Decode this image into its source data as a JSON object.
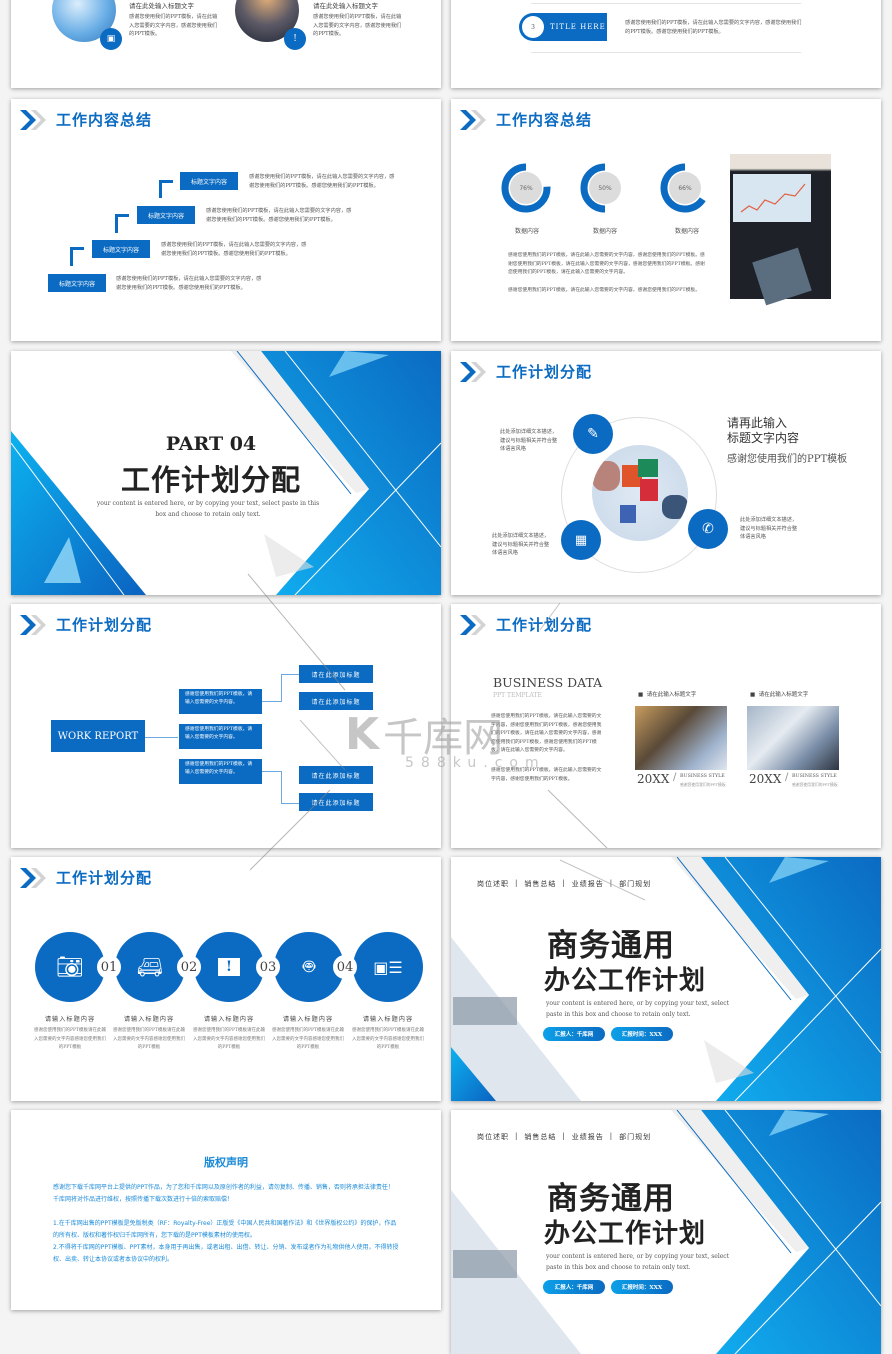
{
  "header_icon": "double-chevron-icon",
  "slide1": {
    "items": [
      {
        "title": "请在此处输入标题文字",
        "body": "感谢您使用我们的PPT模板，请在此输入您需要的文字内容，感谢您使用我们的PPT模板。",
        "icon": "presentation-icon"
      },
      {
        "title": "请在此处输入标题文字",
        "body": "感谢您使用我们的PPT模板，请在此输入您需要的文字内容，感谢您使用我们的PPT模板。",
        "icon": "chat-alert-icon"
      }
    ]
  },
  "slide2": {
    "number": "3",
    "title": "TITLE HERE",
    "body": "感谢您使用我们的PPT模板，请在此输入您需要的文字内容，感谢您使用我们的PPT模板。感谢您使用我们的PPT模板。"
  },
  "slide3": {
    "heading": "工作内容总结",
    "steps": [
      {
        "label": "标题文字内容",
        "body": "感谢您使用我们的PPT模板，请在此输入您需要的文字内容，感谢您使用我们的PPT模板。感谢您使用我们的PPT模板。"
      },
      {
        "label": "标题文字内容",
        "body": "感谢您使用我们的PPT模板，请在此输入您需要的文字内容，感谢您使用我们的PPT模板。感谢您使用我们的PPT模板。"
      },
      {
        "label": "标题文字内容",
        "body": "感谢您使用我们的PPT模板，请在此输入您需要的文字内容，感谢您使用我们的PPT模板。感谢您使用我们的PPT模板。"
      },
      {
        "label": "标题文字内容",
        "body": "感谢您使用我们的PPT模板，请在此输入您需要的文字内容，感谢您使用我们的PPT模板。感谢您使用我们的PPT模板。"
      }
    ]
  },
  "slide4": {
    "heading": "工作内容总结",
    "donuts": [
      {
        "value": 76,
        "text": "76%",
        "label": "数据内容"
      },
      {
        "value": 50,
        "text": "50%",
        "label": "数据内容"
      },
      {
        "value": 66,
        "text": "66%",
        "label": "数据内容"
      }
    ],
    "para1": "感谢您使用我们的PPT模板，请在此输入您需要的文字内容，感谢您使用我们的PPT模板。感谢您使用我们的PPT模板，请在此输入您需要的文字内容，感谢您使用我们的PPT模板。感谢您使用我们的PPT模板，请在此输入您需要的文字内容。",
    "para2": "感谢您使用我们的PPT模板，请在此输入您需要的文字内容，感谢您使用我们的PPT模板。",
    "image": "laptop-chart-photo"
  },
  "slide5": {
    "part": "PART 04",
    "title": "工作计划分配",
    "subtitle": "your content is entered here, or by copying your text, select paste in this box and choose to retain only text."
  },
  "slide6": {
    "heading": "工作计划分配",
    "nodes": [
      {
        "icon": "document-edit-icon",
        "text": "此处添加详细文本描述，建议与标题相关并符合整体语言风格"
      },
      {
        "icon": "calendar-icon",
        "text": "此处添加详细文本描述，建议与标题相关并符合整体语言风格"
      },
      {
        "icon": "phone-icon",
        "text": "此处添加详细文本描述，建议与标题相关并符合整体语言风格"
      }
    ],
    "title_line1": "请再此输入",
    "title_line2": "标题文字内容",
    "body": "感谢您使用我们的PPT模板",
    "image": "puzzle-hands-photo"
  },
  "slide7": {
    "heading": "工作计划分配",
    "root": "WORK REPORT",
    "mid": [
      "感谢您使用我们的PPT模板，请输入您需要的文字内容。",
      "感谢您使用我们的PPT模板，请输入您需要的文字内容。",
      "感谢您使用我们的PPT模板，请输入您需要的文字内容。"
    ],
    "leaves": [
      "请在此添加标题",
      "请在此添加标题",
      "请在此添加标题",
      "请在此添加标题"
    ]
  },
  "slide8": {
    "heading": "工作计划分配",
    "title": "BUSINESS DATA",
    "subtitle": "PPT TEMPLATE",
    "para1": "感谢您使用我们的PPT模板，请在此输入您需要的文字内容，感谢您使用我们的PPT模板，感谢您使用我们的PPT模板，请在此输入您需要的文字内容，感谢您使用我们的PPT模板，感谢您使用我们的PPT模板，请在此输入您需要的文字内容。",
    "para2": "感谢您使用我们的PPT模板，请在此输入您需要的文字内容，感谢您使用我们的PPT模板。",
    "cards": [
      {
        "label": "请在此输入标题文字",
        "year": "20XX",
        "style": "BUSINESS STYLE",
        "desc": "感谢您使用我们的PPT模板",
        "image": "business-desk-photo"
      },
      {
        "label": "请在此输入标题文字",
        "year": "20XX",
        "style": "BUSINESS STYLE",
        "desc": "感谢您使用我们的PPT模板",
        "image": "calculator-documents-photo"
      }
    ]
  },
  "slide9": {
    "heading": "工作计划分配",
    "items": [
      {
        "num": "01",
        "icon": "camera-add-icon",
        "title": "请输入标题内容",
        "body": "感谢您使用我们的PPT模板请在此输入您需要的文字内容感谢您使用我们的PPT模板"
      },
      {
        "num": "02",
        "icon": "van-icon",
        "title": "请输入标题内容",
        "body": "感谢您使用我们的PPT模板请在此输入您需要的文字内容感谢您使用我们的PPT模板"
      },
      {
        "num": "03",
        "icon": "alert-message-icon",
        "title": "请输入标题内容",
        "body": "感谢您使用我们的PPT模板请在此输入您需要的文字内容感谢您使用我们的PPT模板"
      },
      {
        "num": "04",
        "icon": "android-icon",
        "title": "请输入标题内容",
        "body": "感谢您使用我们的PPT模板请在此输入您需要的文字内容感谢您使用我们的PPT模板"
      },
      {
        "num": "",
        "icon": "image-list-icon",
        "title": "请输入标题内容",
        "body": "感谢您使用我们的PPT模板请在此输入您需要的文字内容感谢您使用我们的PPT模板"
      }
    ]
  },
  "cover": {
    "nav": [
      "岗位述职",
      "销售总结",
      "业绩报告",
      "部门规划"
    ],
    "title1": "商务通用",
    "title2": "办公工作计划",
    "subtitle": "your content is entered here, or by copying your text, select paste in this box and choose to retain only text.",
    "reporter": "汇报人：千库网",
    "time": "汇报时间：XXX",
    "image": "laptop-desk-photo"
  },
  "copyright": {
    "title": "版权声明",
    "p1": "感谢您下载千库网平台上提供的PPT作品，为了您和千库网以及原创作者的利益，请勿复制、传播、销售，否则将承担法律责任！千库网将对作品进行维权，按照传播下载次数进行十倍的索取赔偿！",
    "p2": "1.在千库网出售的PPT模板是免版税类（RF：Royalty-Free）正版受《中国人民共和国著作法》和《世界版权公约》的保护，作品的所有权、版权和著作权归千库网所有，您下载的是PPT模板素材的使用权。",
    "p3": "2.不得将千库网的PPT模板、PPT素材，本身用于再出售，或者出租、出借、转让、分销、发布或者作为礼物供他人使用，不得转授权、出卖、转让本协议或者本协议中的权利。"
  },
  "watermark": {
    "brand": "千库网",
    "url": "588ku.com"
  },
  "colors": {
    "accent": "#0b6bc2",
    "light_accent": "#0ca0e8",
    "copyright_text": "#1a8ad8"
  }
}
